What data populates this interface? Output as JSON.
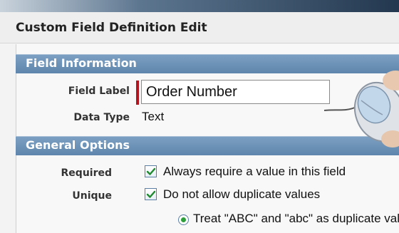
{
  "header": {
    "title": "Custom Field Definition Edit"
  },
  "sections": {
    "field_information": {
      "title": "Field Information",
      "field_label": {
        "label": "Field Label",
        "value": "Order Number"
      },
      "data_type": {
        "label": "Data Type",
        "value": "Text"
      }
    },
    "general_options": {
      "title": "General Options",
      "required": {
        "label": "Required",
        "checked": true,
        "text": "Always require a value in this field"
      },
      "unique": {
        "label": "Unique",
        "checked": true,
        "text": "Do not allow duplicate values"
      },
      "case_option": {
        "selected": true,
        "text": "Treat \"ABC\" and \"abc\" as duplicate values"
      }
    }
  },
  "colors": {
    "section_header": "#6b90b6",
    "required_marker": "#b3151f",
    "radio_dot": "#2c9f3a"
  },
  "icons": [
    "checkbox-checked-icon",
    "radio-selected-icon",
    "computer-mouse-icon"
  ]
}
